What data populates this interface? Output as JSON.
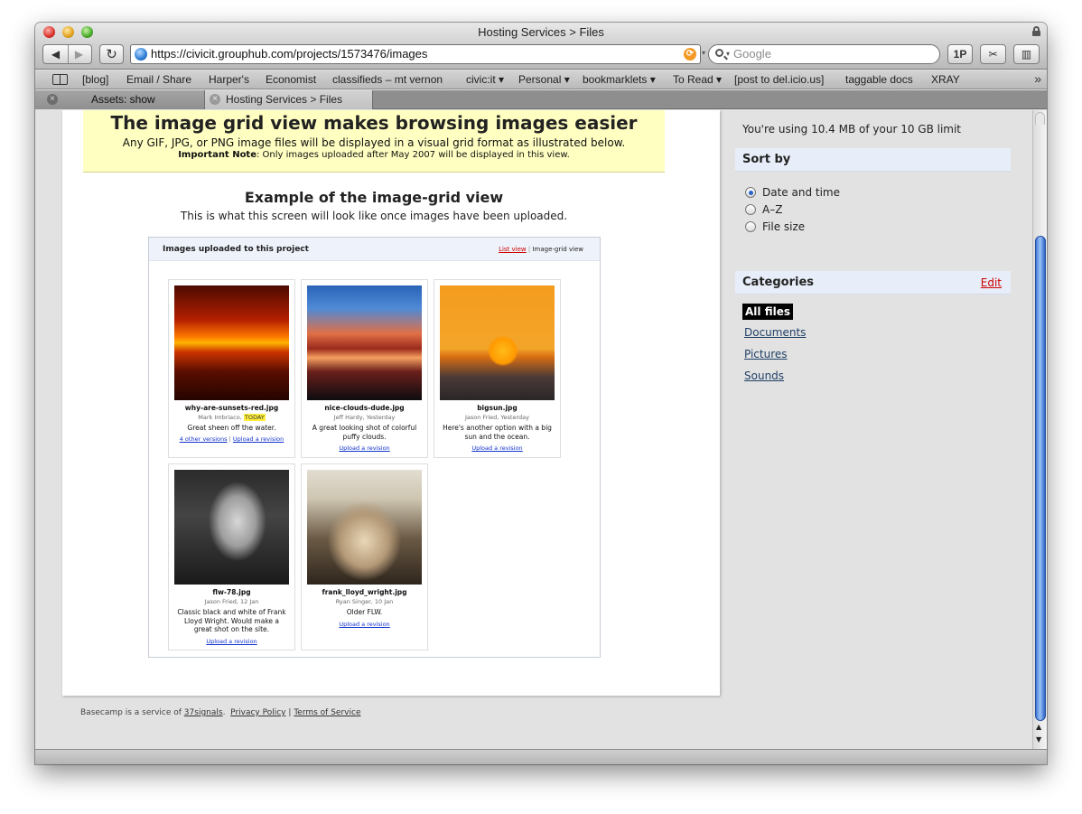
{
  "window": {
    "title": "Hosting Services > Files"
  },
  "toolbar": {
    "back_label": "◀",
    "forward_label": "▶",
    "reload_label": "↻",
    "url": "https://civicit.grouphub.com/projects/1573476/images",
    "search_placeholder": "Google",
    "onepassword_label": "1P",
    "tool2_label": "✂",
    "tool3_label": "▥"
  },
  "bookmarks": [
    "[blog]",
    "Email / Share",
    "Harper's",
    "Economist",
    "classifieds – mt vernon",
    "civic:it ▾",
    "Personal ▾",
    "bookmarklets ▾",
    "To Read ▾",
    "[post to del.icio.us]",
    "taggable docs",
    "XRAY"
  ],
  "bookmarks_more": "»",
  "tabs": [
    {
      "label": "Assets: show"
    },
    {
      "label": "Hosting Services > Files"
    }
  ],
  "banner": {
    "title": "The image grid view makes browsing images easier",
    "subtitle": "Any GIF, JPG, or PNG image files will be displayed in a visual grid format as illustrated below.",
    "note_bold": "Important Note",
    "note_text": ": Only images uploaded after May 2007 will be displayed in this view."
  },
  "example": {
    "title": "Example of the image-grid view",
    "subtitle": "This is what this screen will look like once images have been uploaded."
  },
  "grid": {
    "header": "Images uploaded to this project",
    "list_view": "List view",
    "separator": "|",
    "grid_view": "Image-grid view",
    "cards": [
      {
        "filename": "why-are-sunsets-red.jpg",
        "author": "Mark Imbriaco,",
        "when": "TODAY",
        "description": "Great sheen off the water.",
        "versions": "4 other versions",
        "sep": "|",
        "upload": "Upload a revision"
      },
      {
        "filename": "nice-clouds-dude.jpg",
        "author": "Jeff Hardy, Yesterday",
        "description": "A great looking shot of colorful puffy clouds.",
        "upload": "Upload a revision"
      },
      {
        "filename": "bigsun.jpg",
        "author": "Jason Fried, Yesterday",
        "description": "Here's another option with a big sun and the ocean.",
        "upload": "Upload a revision"
      },
      {
        "filename": "flw-78.jpg",
        "author": "Jason Fried, 12 Jan",
        "description": "Classic black and white of Frank Lloyd Wright. Would make a great shot on the site.",
        "upload": "Upload a revision"
      },
      {
        "filename": "frank_lloyd_wright.jpg",
        "author": "Ryan Singer, 10 Jan",
        "description": "Older FLW.",
        "upload": "Upload a revision"
      }
    ]
  },
  "footer": {
    "prefix": "Basecamp is a service of",
    "company": "37signals",
    "dot": ".",
    "privacy": "Privacy Policy",
    "sep": "|",
    "terms": "Terms of Service"
  },
  "sidebar": {
    "usage": "You're using 10.4 MB of your 10 GB limit",
    "sort_title": "Sort by",
    "sort_options": [
      "Date and time",
      "A–Z",
      "File size"
    ],
    "sort_selected": "Date and time",
    "categories_title": "Categories",
    "categories_edit": "Edit",
    "categories": [
      "All files",
      "Documents",
      "Pictures",
      "Sounds"
    ],
    "category_selected": "All files"
  },
  "scrollbar": {
    "up": "▲",
    "down": "▼"
  }
}
